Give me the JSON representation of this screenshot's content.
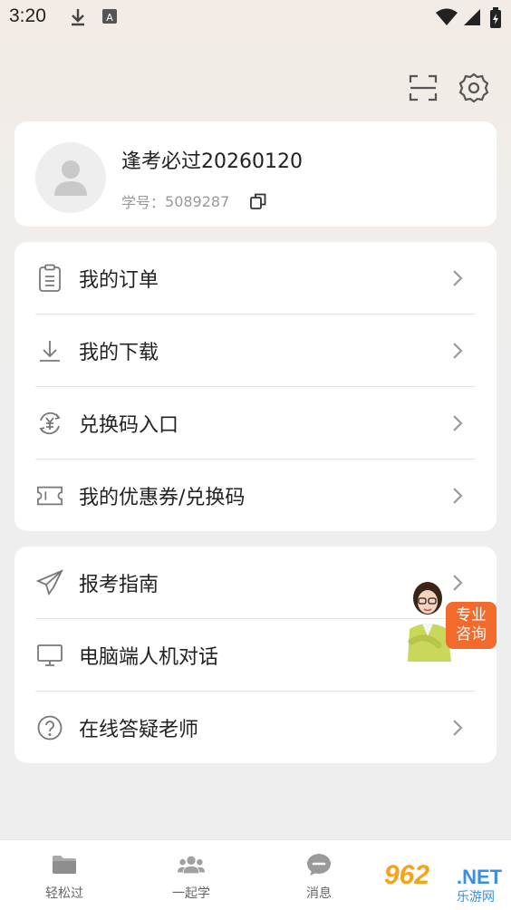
{
  "status_bar": {
    "time": "3:20",
    "icons": [
      "download-icon",
      "a-icon",
      "wifi-icon",
      "signal-icon",
      "battery-icon"
    ]
  },
  "top_actions": {
    "icons": [
      "scan-icon",
      "settings-icon"
    ]
  },
  "profile": {
    "name": "逢考必过20260120",
    "student_id_label": "学号：",
    "student_id": "5089287",
    "copy_icon": "copy-icon"
  },
  "menu_group_1": [
    {
      "label": "我的订单",
      "icon": "order-clipboard-icon"
    },
    {
      "label": "我的下载",
      "icon": "download-icon"
    },
    {
      "label": "兑换码入口",
      "icon": "yuan-exchange-icon"
    },
    {
      "label": "我的优惠券/兑换码",
      "icon": "ticket-icon"
    }
  ],
  "menu_group_2": [
    {
      "label": "报考指南",
      "icon": "paper-plane-icon"
    },
    {
      "label": "电脑端人机对话",
      "icon": "monitor-icon"
    },
    {
      "label": "在线答疑老师",
      "icon": "question-circle-icon"
    }
  ],
  "consult_badge": {
    "line1": "专业",
    "line2": "咨询"
  },
  "tab_bar": [
    {
      "label": "轻松过",
      "icon": "folder-icon"
    },
    {
      "label": "一起学",
      "icon": "group-icon"
    },
    {
      "label": "消息",
      "icon": "message-icon"
    }
  ],
  "watermark": {
    "number": "962",
    "domain": ".NET",
    "site_name": "乐游网"
  },
  "colors": {
    "accent_orange": "#f36b2c",
    "text_primary": "#222222",
    "text_secondary": "#999999",
    "icon_gray": "#888888"
  }
}
